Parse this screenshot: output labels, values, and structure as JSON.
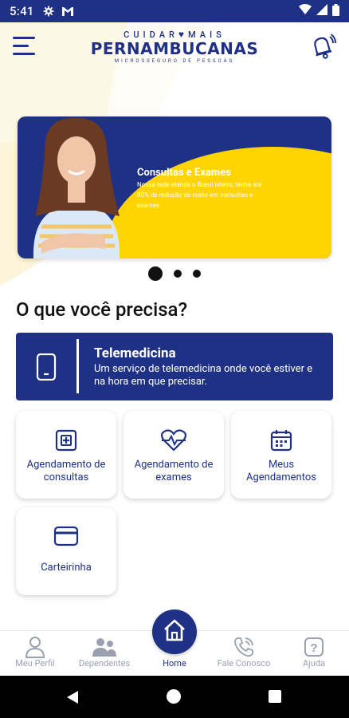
{
  "status_bar": {
    "time": "5:41",
    "icons": [
      "gear-icon",
      "gmail-icon",
      "wifi-icon",
      "signal-icon",
      "battery-icon"
    ]
  },
  "header": {
    "logo_top": "CUIDAR MAIS",
    "logo_main": "PERNAMBUCANAS",
    "logo_sub": "MICROSSEGURO DE PESSOAS",
    "menu_icon": "hamburger-menu-icon",
    "notification_icon": "bell-icon"
  },
  "banner": {
    "title": "Consultas e Exames",
    "text": "Nossa rede atende o Brasil inteiro, tenha até 80% de redução de custo em consultas e exames.",
    "colors": {
      "blue": "#1e3185",
      "yellow": "#ffd400"
    },
    "pages": 3,
    "active_page": 1
  },
  "section_title": "O que você precisa?",
  "telemedicina": {
    "title": "Telemedicina",
    "description": "Um serviço de telemedicina onde você estiver e na hora em que precisar.",
    "icon": "smartphone-icon"
  },
  "services": [
    {
      "label": "Agendamento de consultas",
      "icon": "medical-cross-icon"
    },
    {
      "label": "Agendamento de exames",
      "icon": "heartbeat-icon"
    },
    {
      "label": "Meus Agendamentos",
      "icon": "calendar-icon"
    },
    {
      "label": "Carteirinha",
      "icon": "card-icon"
    }
  ],
  "bottom_nav": {
    "items": [
      {
        "label": "Meu Perfil",
        "icon": "user-icon"
      },
      {
        "label": "Dependentes",
        "icon": "users-icon"
      },
      {
        "label": "Home",
        "icon": "home-icon"
      },
      {
        "label": "Fale Conosco",
        "icon": "phone-call-icon"
      },
      {
        "label": "Ajuda",
        "icon": "question-icon"
      }
    ],
    "active": "Home"
  },
  "theme": {
    "primary": "#1e3185",
    "accent": "#ffd400",
    "inactive": "#9aa0b0"
  }
}
